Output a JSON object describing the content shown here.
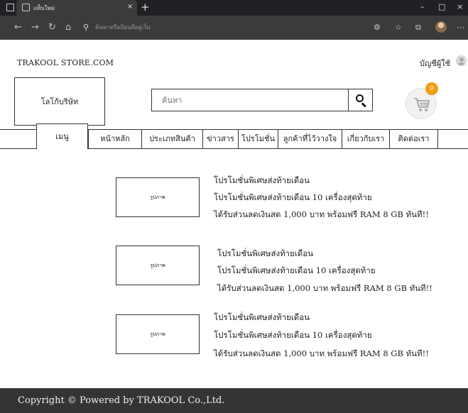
{
  "browser": {
    "tab_title": "แท็บใหม่",
    "tab_close": "×",
    "new_tab": "+",
    "window_controls": [
      "–",
      "□",
      "×"
    ],
    "address_placeholder": "ค้นหาหรือป้อนที่อยู่เว็บ",
    "icons": [
      "window-icon",
      "tab-favicon",
      "back-icon",
      "forward-icon",
      "reload-icon",
      "home-icon",
      "search-icon",
      "settings-icon",
      "favorites-icon",
      "collections-icon",
      "profile-icon",
      "more-icon"
    ]
  },
  "header": {
    "site_name": "TRAKOOL STORE.COM",
    "user_account": "บัญชีผู้ใช้"
  },
  "logo_placeholder": "โลโก้บริษัท",
  "search": {
    "placeholder": "ค้นหา"
  },
  "cart": {
    "count": "0"
  },
  "nav": {
    "items": [
      {
        "label": "เมนู"
      },
      {
        "label": "หน้าหลัก"
      },
      {
        "label": "ประเภทสินค้า"
      },
      {
        "label": "ข่าวสาร"
      },
      {
        "label": "โปรโมชั่น"
      },
      {
        "label": "ลูกค้าที่ไว้วางใจ"
      },
      {
        "label": "เกี่ยวกับเรา"
      },
      {
        "label": "ติดต่อเรา"
      }
    ]
  },
  "promotions": [
    {
      "image_label": "รูปภาพ",
      "lines": [
        "โปรโมชั่นพิเศษส่งท้ายเดือน",
        "โปรโมชั่นพิเศษส่งท้ายเดือน 10 เครื่องสุดท้าย",
        "ได้รับส่วนลดเงินสด 1,000 บาท พร้อมฟรี RAM 8 GB ทันที!!"
      ]
    },
    {
      "image_label": "รูปภาพ",
      "lines": [
        "โปรโมชั่นพิเศษส่งท้ายเดือน",
        "โปรโมชั่นพิเศษส่งท้ายเดือน 10 เครื่องสุดท้าย",
        "ได้รับส่วนลดเงินสด 1,000 บาท พร้อมฟรี RAM 8 GB ทันที!!"
      ]
    },
    {
      "image_label": "รูปภาพ",
      "lines": [
        "โปรโมชั่นพิเศษส่งท้ายเดือน",
        "โปรโมชั่นพิเศษส่งท้ายเดือน 10 เครื่องสุดท้าย",
        "ได้รับส่วนลดเงินสด 1,000 บาท พร้อมฟรี RAM 8 GB ทันที!!"
      ]
    }
  ],
  "footer": {
    "text": "Copyright © Powered by TRAKOOL Co.,Ltd."
  },
  "colors": {
    "cart_badge": "#f39c12",
    "footer_bg": "#343434",
    "chrome_dark": "#202124",
    "chrome_toolbar": "#3b3b3b"
  }
}
